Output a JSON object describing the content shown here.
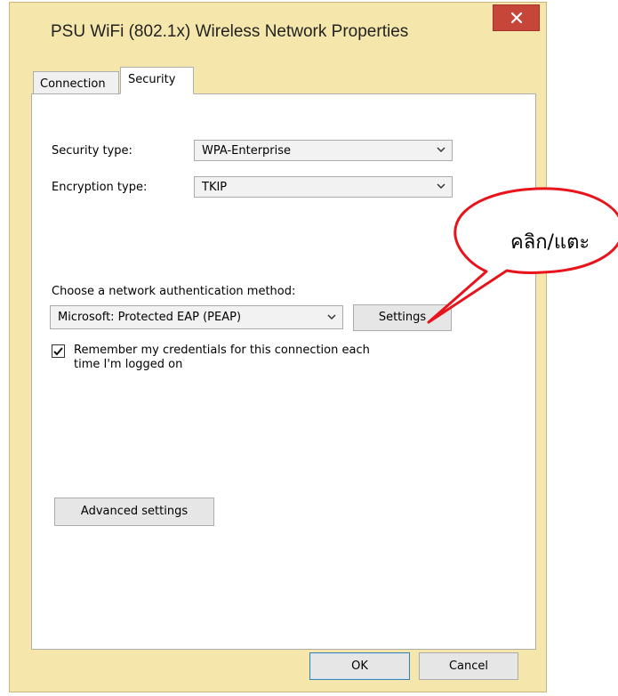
{
  "window": {
    "title": "PSU WiFi (802.1x) Wireless Network Properties",
    "close_icon": "close-icon"
  },
  "tabs": [
    {
      "label": "Connection",
      "active": false
    },
    {
      "label": "Security",
      "active": true
    }
  ],
  "security": {
    "security_type_label": "Security type:",
    "security_type_value": "WPA-Enterprise",
    "encryption_type_label": "Encryption type:",
    "encryption_type_value": "TKIP",
    "auth_method_label": "Choose a network authentication method:",
    "auth_method_value": "Microsoft: Protected EAP (PEAP)",
    "settings_label": "Settings",
    "remember_label_line1": "Remember my credentials for this connection each",
    "remember_label_line2": "time I'm logged on",
    "remember_checked": true,
    "advanced_label": "Advanced settings"
  },
  "footer": {
    "ok_label": "OK",
    "cancel_label": "Cancel"
  },
  "annotation": {
    "callout_text": "คลิก/แตะ",
    "callout_color": "#e8141b"
  }
}
